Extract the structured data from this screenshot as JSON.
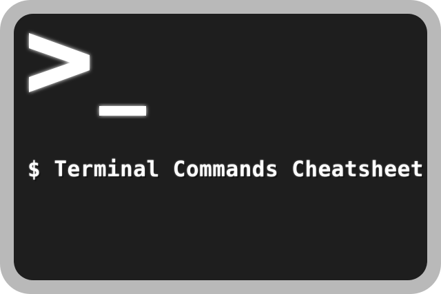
{
  "title": "$ Terminal Commands Cheatsheet",
  "icon": "terminal-prompt-icon",
  "colors": {
    "frame": "#b9b9b9",
    "screen": "#1e1e1e",
    "glyph": "#ffffff"
  }
}
